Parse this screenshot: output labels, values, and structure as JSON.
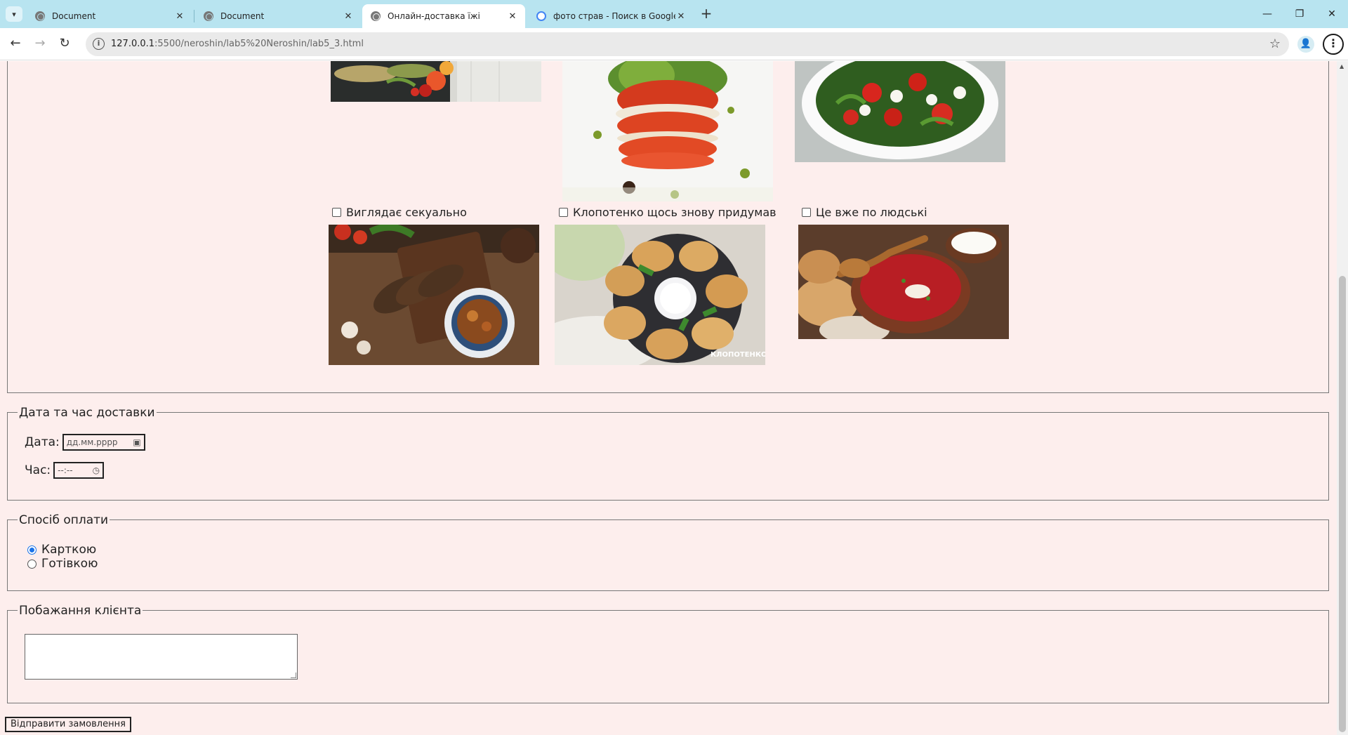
{
  "browser": {
    "tabs": [
      {
        "title": "Document",
        "active": false,
        "icon": "globe-icon"
      },
      {
        "title": "Document",
        "active": false,
        "icon": "globe-icon"
      },
      {
        "title": "Онлайн-доставка їжі",
        "active": true,
        "icon": "globe-icon"
      },
      {
        "title": "фото страв - Поиск в Google",
        "active": false,
        "icon": "google-icon"
      }
    ],
    "url_host": "127.0.0.1",
    "url_rest": ":5500/neroshin/lab5%20Neroshin/lab5_3.html"
  },
  "dishes": {
    "items": [
      {
        "label": "Виглядає секуально",
        "checked": false
      },
      {
        "label": "Клопотенко щось знову придумав",
        "checked": false
      },
      {
        "label": "Це вже по людські",
        "checked": false
      }
    ],
    "watermark": "КЛОПОТЕНКО"
  },
  "delivery": {
    "legend": "Дата та час доставки",
    "date_label": "Дата:",
    "date_placeholder": "дд.мм.рррр",
    "time_label": "Час:",
    "time_placeholder": "--:--"
  },
  "payment": {
    "legend": "Спосіб оплати",
    "options": [
      {
        "label": "Карткою",
        "selected": true
      },
      {
        "label": "Готівкою",
        "selected": false
      }
    ]
  },
  "wishes": {
    "legend": "Побажання клієнта",
    "value": ""
  },
  "submit_label": "Відправити замовлення",
  "colors": {
    "page_background": "#fdeeed",
    "tabbar_background": "#b8e4f0",
    "radio_accent": "#1a73e8"
  }
}
